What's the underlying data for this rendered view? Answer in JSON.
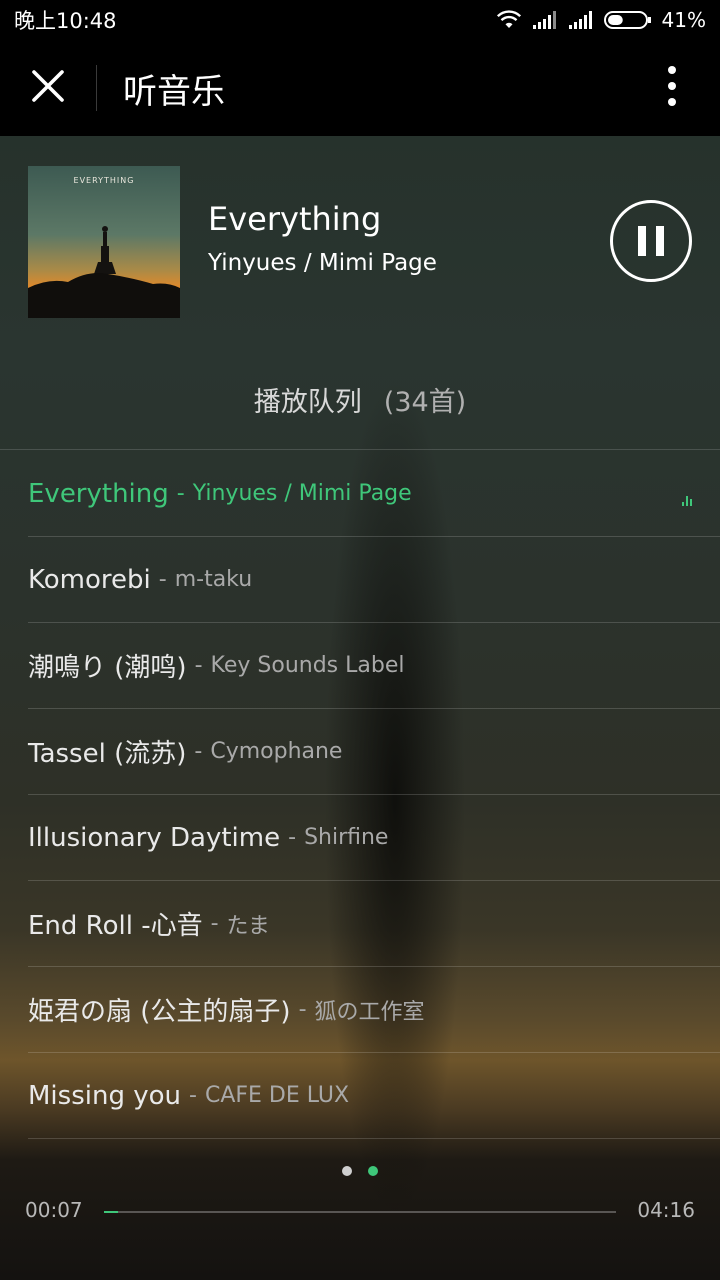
{
  "status_bar": {
    "time": "晚上10:48",
    "battery_percent": "41%",
    "battery_level": 0.41,
    "icons": [
      "wifi-icon",
      "signal-icon",
      "signal-icon",
      "battery-icon"
    ]
  },
  "header": {
    "title": "听音乐",
    "close_icon": "close-icon",
    "menu_icon": "more-vertical-icon"
  },
  "now_playing": {
    "cover_text": "EVERYTHING",
    "title": "Everything",
    "artist": "Yinyues / Mimi Page",
    "control_icon": "pause-icon"
  },
  "queue": {
    "label": "播放队列",
    "count": "(34首)",
    "separator": "-",
    "items": [
      {
        "song": "Everything",
        "artist": "Yinyues / Mimi Page",
        "active": true
      },
      {
        "song": "Komorebi",
        "artist": "m-taku"
      },
      {
        "song": "潮鳴り (潮鸣)",
        "artist": "Key Sounds Label"
      },
      {
        "song": "Tassel (流苏)",
        "artist": "Cymophane"
      },
      {
        "song": "Illusionary Daytime",
        "artist": "Shirfine"
      },
      {
        "song": "End Roll -心音",
        "artist": "たま"
      },
      {
        "song": "姫君の扇 (公主的扇子)",
        "artist": "狐の工作室"
      },
      {
        "song": "Missing you",
        "artist": "CAFE DE LUX"
      }
    ]
  },
  "pager": {
    "pages": 2,
    "current": 2
  },
  "progress": {
    "elapsed": "00:07",
    "total": "04:16",
    "fraction": 0.027
  },
  "colors": {
    "accent": "#3fc77a",
    "header_bg": "#000000",
    "dot_inactive": "#cfcfcf"
  }
}
